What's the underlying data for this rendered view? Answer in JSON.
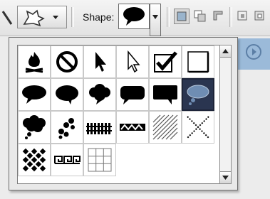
{
  "toolbar": {
    "shape_label": "Shape:",
    "preset_picker_icon": "custom-shape-icon",
    "current_shape_icon": "speech-bubble-icon",
    "mode_icons": [
      "new-layer-icon",
      "add-to-shape-icon",
      "subtract-shape-icon",
      "intersect-shape-icon",
      "exclude-shape-icon"
    ]
  },
  "shapes": [
    {
      "icon": "fire-icon"
    },
    {
      "icon": "no-sign-icon"
    },
    {
      "icon": "arrow-pointer-icon"
    },
    {
      "icon": "arrow-pointer-outline-icon"
    },
    {
      "icon": "checkbox-checked-icon"
    },
    {
      "icon": "blank-square-icon"
    },
    {
      "icon": "speech-bubble-oval-icon"
    },
    {
      "icon": "speech-bubble-round-icon"
    },
    {
      "icon": "thought-bubble-icon"
    },
    {
      "icon": "speech-bubble-rounded-rect-icon"
    },
    {
      "icon": "speech-bubble-rect-icon"
    },
    {
      "icon": "thought-bubble-selected-icon",
      "selected": true
    },
    {
      "icon": "thought-bubble-large-icon"
    },
    {
      "icon": "paw-prints-icon"
    },
    {
      "icon": "fence-icon"
    },
    {
      "icon": "zigzag-border-icon"
    },
    {
      "icon": "diagonal-hatch-icon"
    },
    {
      "icon": "cross-dots-icon"
    },
    {
      "icon": "checker-diamond-icon"
    },
    {
      "icon": "greek-key-icon"
    },
    {
      "icon": "grid-icon"
    }
  ],
  "colors": {
    "selected_cell": "#2a3550",
    "side_button": "#9bbad9"
  }
}
